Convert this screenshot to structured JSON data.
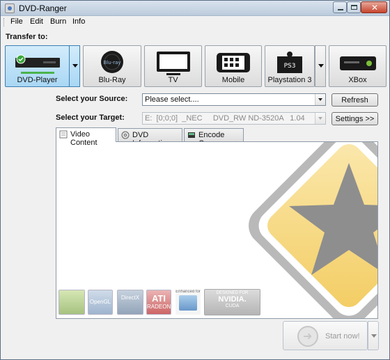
{
  "window": {
    "title": "DVD-Ranger"
  },
  "menu": [
    "File",
    "Edit",
    "Burn",
    "Info"
  ],
  "transfer_label": "Transfer to:",
  "devices": [
    {
      "label": "DVD-Player",
      "icon": "dvd-player-icon",
      "active": true
    },
    {
      "label": "Blu-Ray",
      "icon": "bluray-disc-icon"
    },
    {
      "label": "TV",
      "icon": "tv-icon"
    },
    {
      "label": "Mobile",
      "icon": "mobile-phone-icon"
    },
    {
      "label": "Playstation 3",
      "icon": "playstation-icon"
    },
    {
      "label": "XBox",
      "icon": "xbox-icon"
    }
  ],
  "source": {
    "label": "Select your Source:",
    "value": "Please select....",
    "button": "Refresh"
  },
  "target": {
    "label": "Select your Target:",
    "value": "E:  [0;0;0]  _NEC     DVD_RW ND-3520A   1.04",
    "button": "Settings >>"
  },
  "tabs": [
    {
      "label": "Video Content",
      "icon": "document-icon",
      "active": true
    },
    {
      "label": "DVD Information",
      "icon": "disc-icon"
    },
    {
      "label": "Encode Queue",
      "icon": "queue-icon"
    }
  ],
  "badges": [
    {
      "name": "nvidia-physx-badge",
      "text": ""
    },
    {
      "name": "opengl-badge",
      "text": "OpenGL"
    },
    {
      "name": "directx-badge",
      "text": "DirectX"
    },
    {
      "name": "ati-radeon-badge",
      "text": "ATI",
      "sub": "RADEON"
    },
    {
      "name": "intel-core-badge",
      "text": "Enhanced for"
    },
    {
      "name": "nvidia-cuda-badge",
      "text": "DESIGNED FOR",
      "main": "NVIDIA.",
      "sub": "CUDA"
    }
  ],
  "start_button": "Start now!",
  "colors": {
    "accent": "#3c7fb1",
    "sign_yellow": "#f5d57a",
    "sign_star": "#8e8e8e"
  }
}
